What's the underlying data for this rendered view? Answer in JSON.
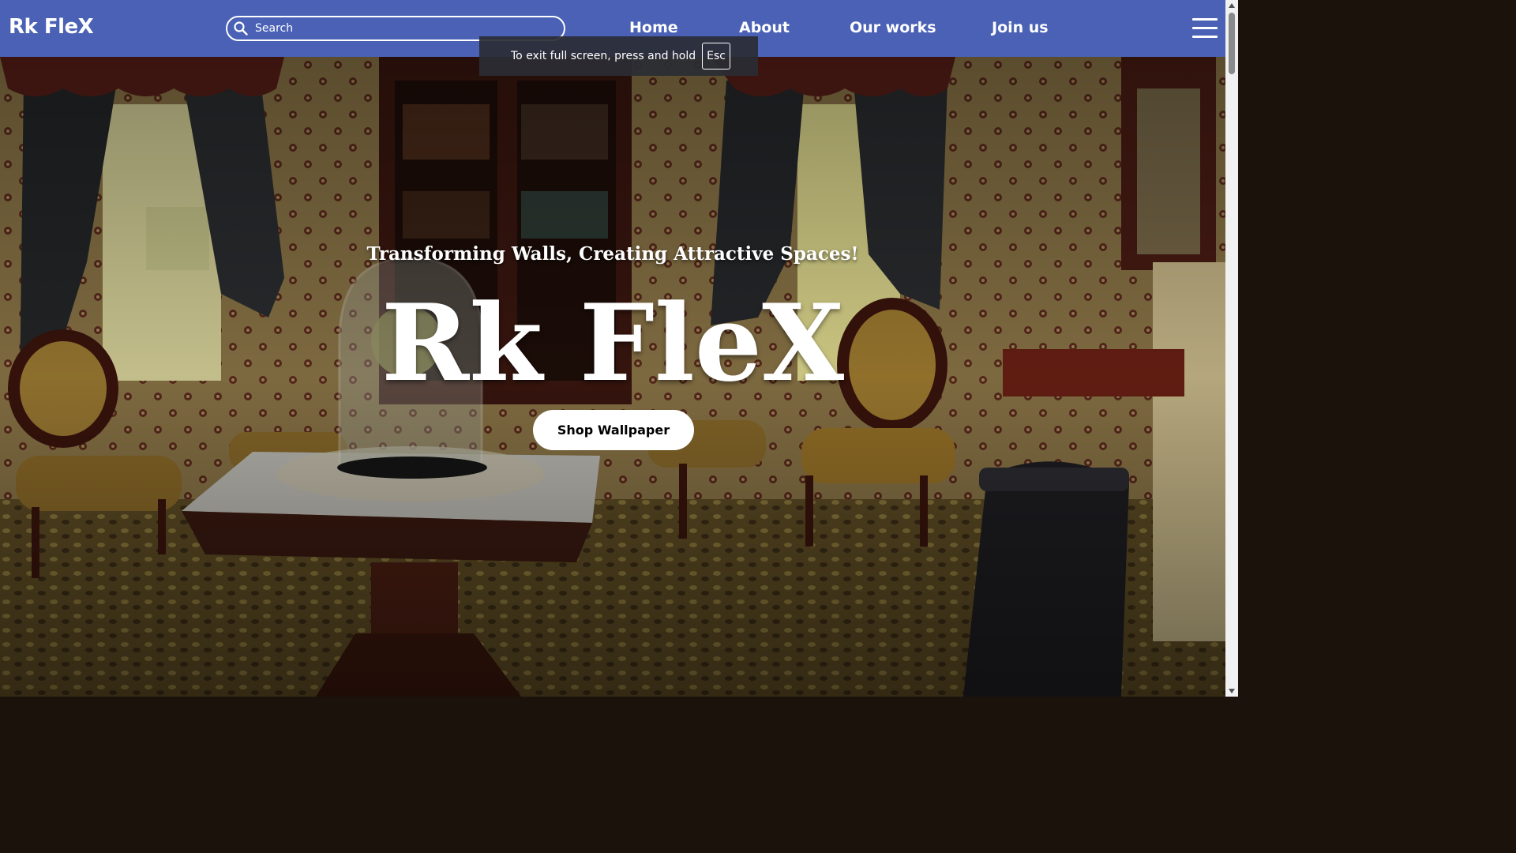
{
  "navbar": {
    "brand": "Rk FleX",
    "search_placeholder": "Search",
    "links": [
      "Home",
      "About",
      "Our works",
      "Join us"
    ],
    "menu_icon": "hamburger-menu-icon",
    "background_color": "#4a61b5"
  },
  "fullscreen_notice": {
    "text": "To exit full screen, press and hold",
    "key": "Esc"
  },
  "hero": {
    "tagline": "Transforming Walls, Creating Attractive Spaces!",
    "title": "Rk FleX",
    "cta_label": "Shop Wallpaper"
  },
  "scrollbar": {
    "position": 0
  }
}
